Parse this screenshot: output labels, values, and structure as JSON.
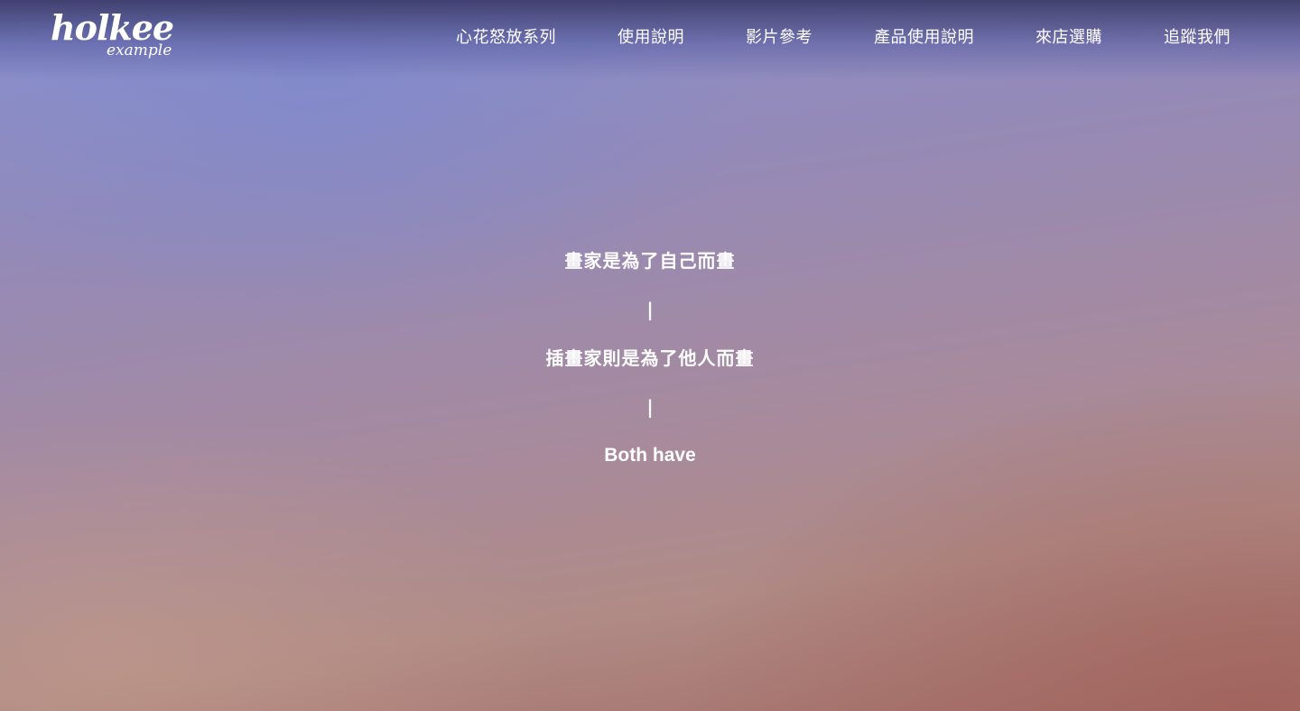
{
  "logo": {
    "main": "holkee",
    "sub": "example"
  },
  "nav": {
    "items": [
      {
        "label": "心花怒放系列"
      },
      {
        "label": "使用說明"
      },
      {
        "label": "影片參考"
      },
      {
        "label": "產品使用說明"
      },
      {
        "label": "來店選購"
      },
      {
        "label": "追蹤我們"
      }
    ]
  },
  "hero": {
    "line1": "畫家是為了自己而畫",
    "separator1": "|",
    "line2": "插畫家則是為了他人而畫",
    "separator2": "|",
    "line3": "Both have"
  },
  "colors": {
    "text": "#ffffff",
    "header_top": "#343460",
    "bg_top": "#8a90cc",
    "bg_bottom": "#a46e68"
  }
}
